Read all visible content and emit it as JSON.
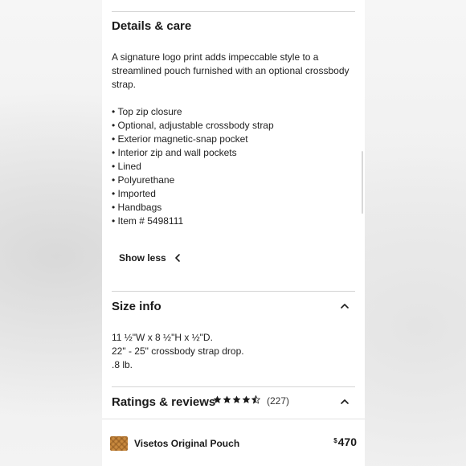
{
  "details": {
    "title": "Details & care",
    "description_lines": [
      "A signature logo print adds impeccable style to a",
      "streamlined pouch furnished with an optional crossbody",
      "strap."
    ],
    "bullets": [
      "Top zip closure",
      "Optional, adjustable crossbody strap",
      "Exterior magnetic-snap pocket",
      "Interior zip and wall pockets",
      "Lined",
      "Polyurethane",
      "Imported",
      "Handbags",
      "Item # 5498111"
    ],
    "show_less_label": "Show less"
  },
  "size_info": {
    "title": "Size info",
    "lines": [
      "11 ½\"W x 8 ½\"H x ½\"D.",
      "22\" - 25\" crossbody strap drop.",
      ".8 lb."
    ]
  },
  "ratings": {
    "title": "Ratings & reviews",
    "stars": 4.5,
    "count": "(227)"
  },
  "product_bar": {
    "name": "Visetos Original Pouch",
    "currency": "$",
    "price": "470"
  },
  "colors": {
    "text": "#1a1a1a",
    "divider": "#d4d4d4",
    "thumb": "#c98a3f",
    "background": "#ececec"
  },
  "icons": {
    "show_less": "chevron-left-icon",
    "collapse": "chevron-up-icon",
    "star": "star-icon"
  }
}
